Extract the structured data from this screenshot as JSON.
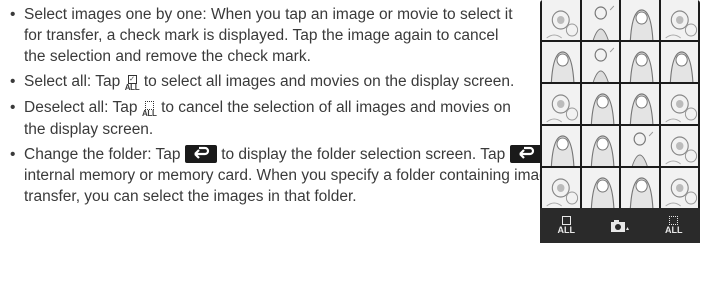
{
  "bullets": [
    {
      "text": "Select images one by one: When you tap an image or movie to select it for transfer, a check mark is displayed. Tap the image again to cancel the selection and remove the check mark."
    },
    {
      "text_before": "Select all: Tap",
      "icon": "select-all-icon",
      "icon_label": "ALL",
      "text_after": "to select all images and movies on the display screen."
    },
    {
      "text_before": "Deselect all: Tap",
      "icon": "deselect-all-icon",
      "icon_label": "ALL",
      "text_after": "to cancel the selection of all images and movies on the display screen."
    },
    {
      "text_before": "Change the folder: Tap",
      "icon": "return-icon",
      "text_mid": "to display the folder selection screen. Tap",
      "text_after": "again to select the internal memory or memory card. When you specify a folder containing images you want to transfer, you can select the images in that folder."
    }
  ],
  "screen": {
    "toolbar": {
      "select_all_label": "ALL",
      "deselect_all_label": "ALL",
      "camera_icon": "camera-icon"
    },
    "thumbnails": [
      "flowers",
      "child",
      "woman",
      "flowers",
      "woman",
      "child",
      "woman",
      "woman",
      "flowers",
      "woman",
      "woman",
      "flowers",
      "woman",
      "woman",
      "child",
      "flowers",
      "flowers",
      "woman",
      "woman",
      "flowers"
    ]
  },
  "colors": {
    "text": "#3a3a3a",
    "screen_bg": "#1c1c1c",
    "toolbar_bg": "#2a2a2a"
  }
}
